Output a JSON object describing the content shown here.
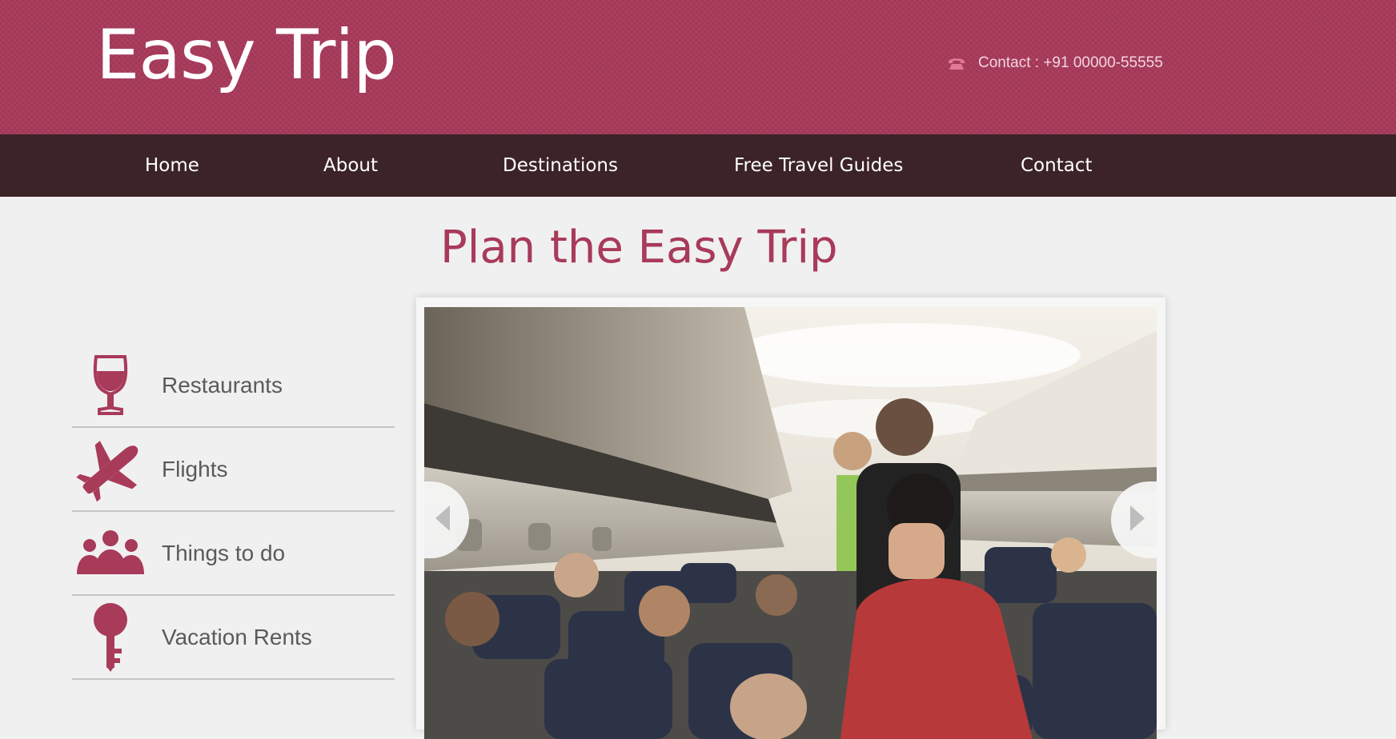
{
  "header": {
    "logo": "Easy Trip",
    "contact": "Contact : +91 00000-55555"
  },
  "nav": {
    "items": [
      {
        "label": "Home"
      },
      {
        "label": "About"
      },
      {
        "label": "Destinations"
      },
      {
        "label": "Free Travel Guides"
      },
      {
        "label": "Contact"
      }
    ]
  },
  "main": {
    "title": "Plan the Easy Trip"
  },
  "sidebar": {
    "items": [
      {
        "label": "Restaurants",
        "icon": "wine-glass-icon"
      },
      {
        "label": "Flights",
        "icon": "airplane-icon"
      },
      {
        "label": "Things to do",
        "icon": "people-group-icon"
      },
      {
        "label": "Vacation Rents",
        "icon": "key-icon"
      }
    ]
  },
  "slider": {
    "image": "airplane-cabin-passengers",
    "prev_icon": "chevron-left-icon",
    "next_icon": "chevron-right-icon"
  },
  "colors": {
    "brand": "#a83a5a",
    "nav_background": "#3b2328",
    "page_background": "#f0f0f0",
    "sidebar_text": "#5a5a5a"
  }
}
